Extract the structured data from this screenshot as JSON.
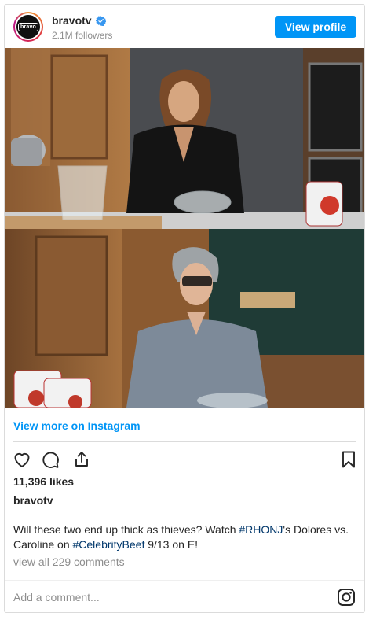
{
  "header": {
    "username": "bravotv",
    "avatar_text": "bravo",
    "followers": "2.1M followers",
    "view_profile_label": "View profile"
  },
  "post": {
    "view_more_label": "View more on Instagram",
    "likes": "11,396 likes",
    "author": "bravotv",
    "caption": {
      "part1": "Will these two end up thick as thieves? Watch ",
      "tag1": "#RHONJ",
      "part2": "'s Dolores vs. Caroline on ",
      "tag2": "#CelebrityBeef",
      "part3": " 9/13 on E!"
    },
    "comments_link": "view all 229 comments",
    "add_comment_placeholder": "Add a comment..."
  },
  "icons": {
    "verified": "verified-badge-icon",
    "like": "heart-icon",
    "comment": "comment-bubble-icon",
    "share": "share-icon",
    "save": "bookmark-icon",
    "instagram": "instagram-logo-icon"
  },
  "colors": {
    "accent": "#0095f6",
    "hashtag": "#00376b",
    "muted": "#8e8e8e"
  }
}
